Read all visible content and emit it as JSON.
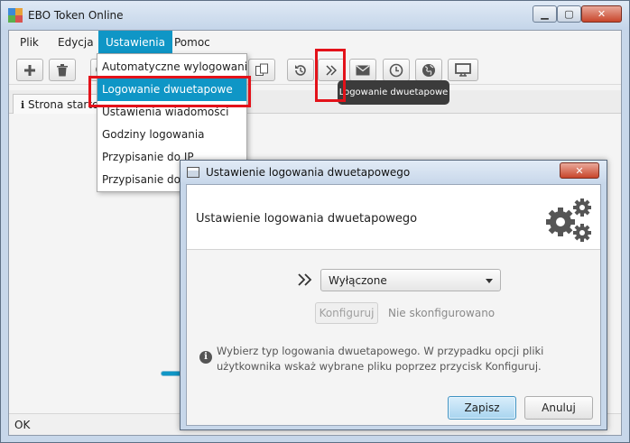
{
  "window": {
    "title": "EBO Token Online",
    "minimize_glyph": "▁",
    "maximize_glyph": "▢",
    "close_glyph": "✕"
  },
  "menubar": {
    "items": [
      {
        "label": "Plik"
      },
      {
        "label": "Edycja"
      },
      {
        "label": "Ustawienia"
      },
      {
        "label": "Pomoc"
      }
    ],
    "active": "Ustawienia"
  },
  "toolbar": {
    "buttons": [
      {
        "icon": "plus-icon"
      },
      {
        "icon": "trash-icon"
      },
      {
        "icon": "search-icon"
      },
      {
        "icon": "copy-icon"
      },
      {
        "icon": "history-icon"
      },
      {
        "icon": "double-chevron-icon"
      },
      {
        "icon": "envelope-icon"
      },
      {
        "icon": "clock-icon"
      },
      {
        "icon": "globe-icon"
      },
      {
        "icon": "monitor-icon"
      }
    ]
  },
  "tabs": {
    "start_label": "Strona startowa",
    "start_icon": "info-icon"
  },
  "dropdown": {
    "items": [
      {
        "label": "Automatyczne wylogowanie"
      },
      {
        "label": "Logowanie dwuetapowe"
      },
      {
        "label": "Ustawienia wiadomości"
      },
      {
        "label": "Godziny logowania"
      },
      {
        "label": "Przypisanie do IP"
      },
      {
        "label": "Przypisanie do k"
      }
    ],
    "selected": "Logowanie dwuetapowe"
  },
  "tooltip": {
    "text": "Logowanie dwuetapowe"
  },
  "status": {
    "text": "OK"
  },
  "dialog": {
    "title": "Ustawienie logowania dwuetapowego",
    "header": "Ustawienie logowania dwuetapowego",
    "header_icon": "gears-icon",
    "select_value": "Wyłączone",
    "configure_label": "Konfiguruj",
    "config_status": "Nie skonfigurowano",
    "info_text": "Wybierz typ  logowania dwuetapowego. W przypadku opcji  pliki użytkownika wskaż wybrane pliku poprzez przycisk Konfiguruj.",
    "save_label": "Zapisz",
    "cancel_label": "Anuluj",
    "close_glyph": "✕"
  },
  "colors": {
    "accent": "#0f96c6",
    "highlight_box": "#e3121a",
    "app_icon": [
      "#3d8ad6",
      "#e8a23a",
      "#5bb04d",
      "#d9534f"
    ]
  }
}
